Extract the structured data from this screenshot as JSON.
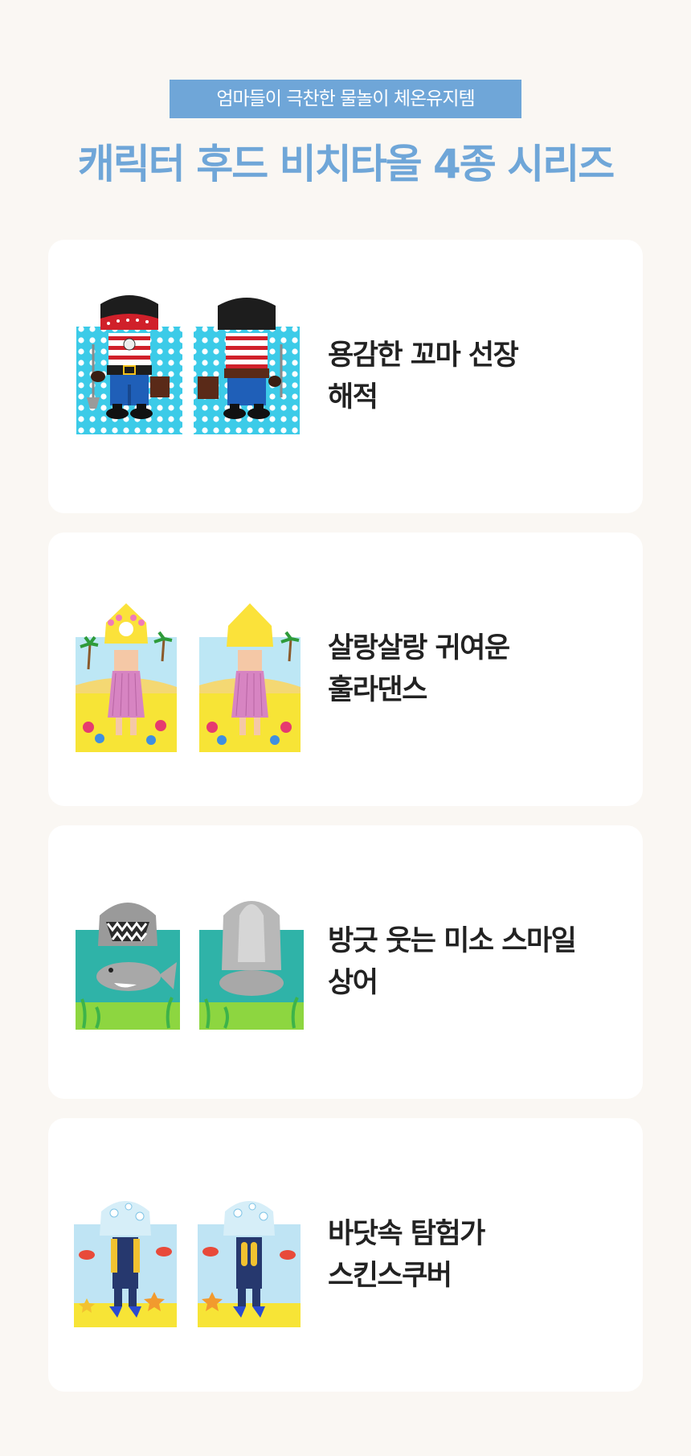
{
  "header": {
    "badge": "엄마들이 극찬한 물놀이 체온유지템",
    "title": "캐릭터 후드 비치타올 4종 시리즈"
  },
  "products": [
    {
      "line1": "용감한 꼬마 선장",
      "line2": "해적",
      "image": "pirate-hooded-towel-front-and-back"
    },
    {
      "line1": "살랑살랑 귀여운",
      "line2": "훌라댄스",
      "image": "hula-dancer-hooded-towel-front-and-back"
    },
    {
      "line1": "방긋 웃는 미소 스마일",
      "line2": "상어",
      "image": "shark-hooded-towel-front-and-back"
    },
    {
      "line1": "바닷속 탐험가",
      "line2": "스킨스쿠버",
      "image": "scuba-diver-hooded-towel-front-and-back"
    }
  ],
  "colors": {
    "accent": "#6fa6d8",
    "background": "#faf7f3",
    "card": "#ffffff",
    "text": "#222222"
  }
}
